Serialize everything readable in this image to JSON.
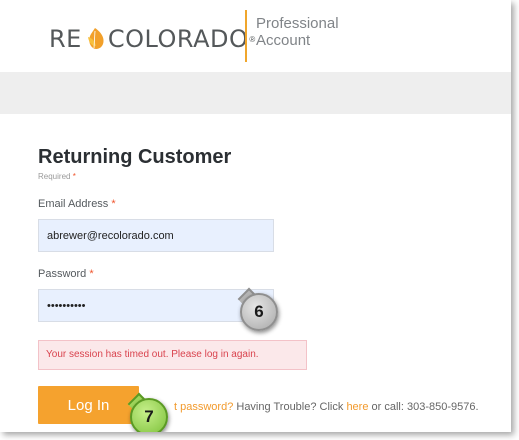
{
  "brand": {
    "logo_left": "RE",
    "logo_right": "COLORADO",
    "logo_mark": "®",
    "subtitle_line1": "Professional",
    "subtitle_line2": "Account"
  },
  "form": {
    "title": "Returning Customer",
    "required_note": "Required",
    "required_star": "*",
    "email_label": "Email Address",
    "email_value": "abrewer@recolorado.com",
    "password_label": "Password",
    "password_value": "••••••••••",
    "error_message": "Your session has timed out. Please log in again.",
    "login_button": "Log In",
    "forgot_fragment": "t password?",
    "help_text_1": "Having Trouble? Click",
    "help_link": "here",
    "help_text_2": "or call: 303-850-9576."
  },
  "callouts": {
    "step_password": "6",
    "step_login": "7"
  },
  "colors": {
    "accent": "#f5a22e",
    "link": "#f29a2c",
    "error": "#d9434e",
    "error_bg": "#fbe8ea",
    "field_bg": "#e8f0fe",
    "callout_grey": "#a8a8a8",
    "callout_green": "#7dc13a"
  },
  "icons": {
    "brand": "leaf-logo-icon"
  }
}
